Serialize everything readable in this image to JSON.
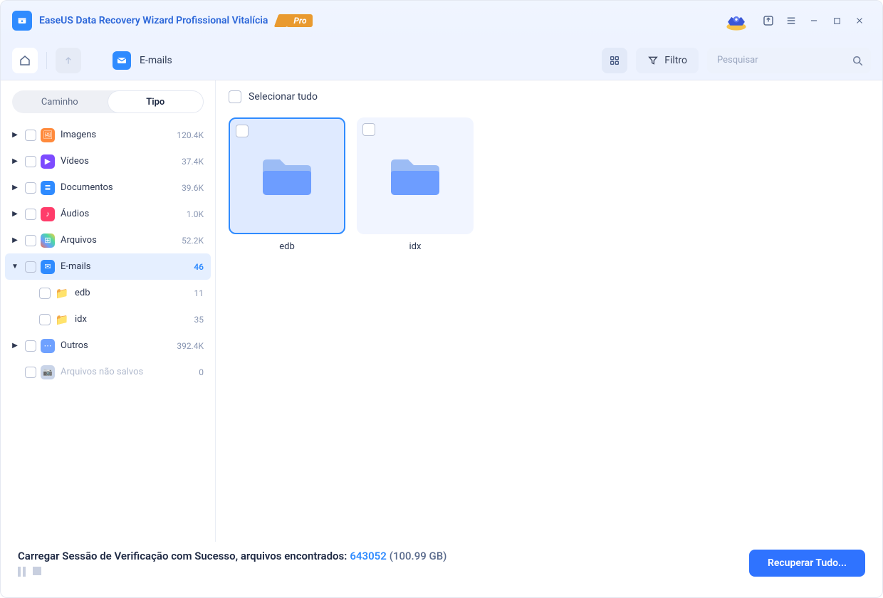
{
  "title": "EaseUS Data Recovery Wizard Profissional Vitalícia",
  "pro_label": "Pro",
  "breadcrumb": {
    "label": "E-mails"
  },
  "toolbar": {
    "filter": "Filtro",
    "search_placeholder": "Pesquisar"
  },
  "segments": {
    "path": "Caminho",
    "type": "Tipo"
  },
  "tree": [
    {
      "label": "Imagens",
      "count": "120.4K",
      "icon": "cat-img",
      "arrow": "right"
    },
    {
      "label": "Vídeos",
      "count": "37.4K",
      "icon": "cat-vid",
      "arrow": "right"
    },
    {
      "label": "Documentos",
      "count": "39.6K",
      "icon": "cat-doc",
      "arrow": "right"
    },
    {
      "label": "Áudios",
      "count": "1.0K",
      "icon": "cat-aud",
      "arrow": "right"
    },
    {
      "label": "Arquivos",
      "count": "52.2K",
      "icon": "cat-arc",
      "arrow": "right"
    },
    {
      "label": "E-mails",
      "count": "46",
      "icon": "cat-mail",
      "arrow": "down",
      "selected": true
    },
    {
      "label": "edb",
      "count": "11",
      "icon": "cat-folder",
      "child": true
    },
    {
      "label": "idx",
      "count": "35",
      "icon": "cat-folder",
      "child": true
    },
    {
      "label": "Outros",
      "count": "392.4K",
      "icon": "cat-other",
      "arrow": "right"
    },
    {
      "label": "Arquivos não salvos",
      "count": "0",
      "icon": "cat-uns",
      "muted": true
    }
  ],
  "select_all": "Selecionar tudo",
  "cards": [
    {
      "name": "edb",
      "selected": true
    },
    {
      "name": "idx",
      "selected": false
    }
  ],
  "footer": {
    "prefix": "Carregar Sessão de Verificação com Sucesso, arquivos encontrados: ",
    "count": "643052",
    "size": "(100.99 GB)",
    "recover": "Recuperar Tudo..."
  }
}
